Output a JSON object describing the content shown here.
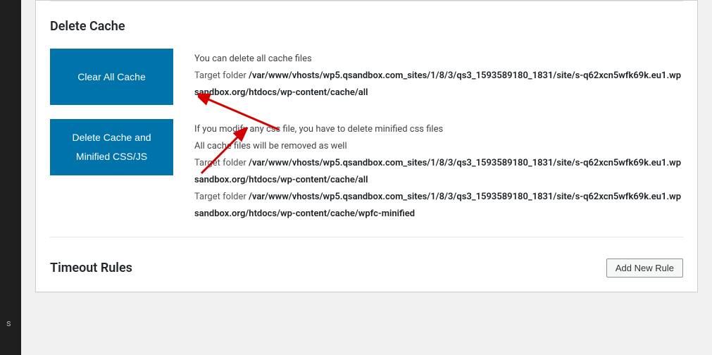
{
  "sidebar": {
    "fragment": "s"
  },
  "sections": {
    "deleteCache": {
      "heading": "Delete Cache",
      "clearAll": {
        "buttonLabel": "Clear All Cache",
        "desc1": "You can delete all cache files",
        "targetLabel": "Target folder ",
        "path1": "/var/www/vhosts/wp5.qsandbox.com_sites/1/8/3/qs3_1593589180_1831/site/s-q62xcn5wfk69k.eu1.wpsandbox.org/htdocs/wp-content/cache/all"
      },
      "deleteMinified": {
        "buttonLabel": "Delete Cache and Minified CSS/JS",
        "desc1": "If you modify any css file, you have to delete minified css files",
        "desc2": "All cache files will be removed as well",
        "targetLabel1": "Target folder ",
        "path1": "/var/www/vhosts/wp5.qsandbox.com_sites/1/8/3/qs3_1593589180_1831/site/s-q62xcn5wfk69k.eu1.wpsandbox.org/htdocs/wp-content/cache/all",
        "targetLabel2": "Target folder ",
        "path2": "/var/www/vhosts/wp5.qsandbox.com_sites/1/8/3/qs3_1593589180_1831/site/s-q62xcn5wfk69k.eu1.wpsandbox.org/htdocs/wp-content/cache/wpfc-minified"
      }
    },
    "timeoutRules": {
      "heading": "Timeout Rules",
      "addButtonLabel": "Add New Rule"
    }
  }
}
